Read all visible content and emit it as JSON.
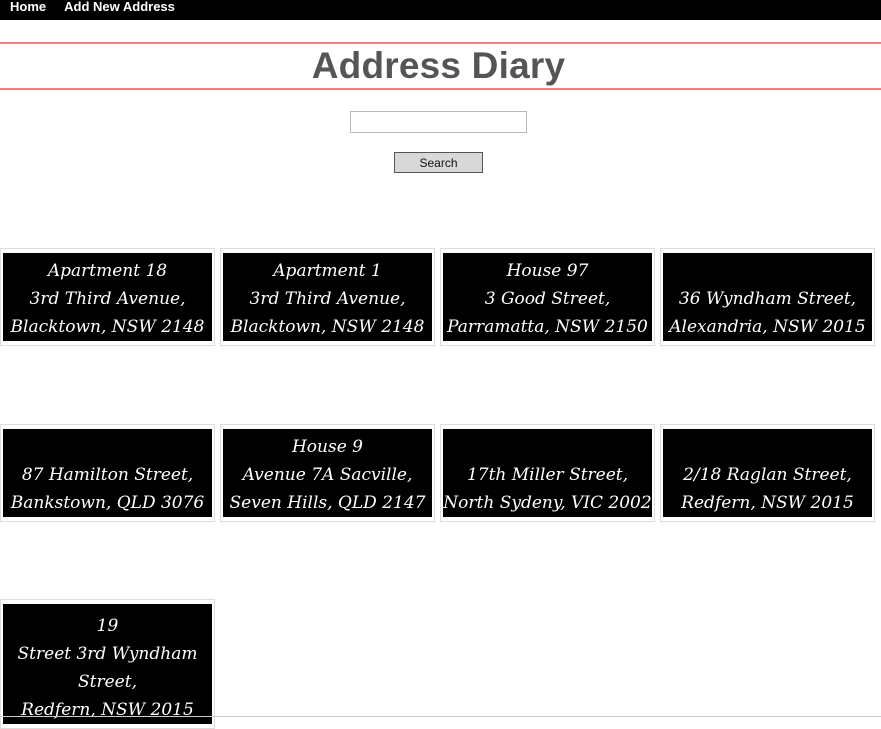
{
  "nav": {
    "home_label": "Home",
    "add_label": "Add New Address"
  },
  "header": {
    "title": "Address Diary"
  },
  "search": {
    "value": "",
    "placeholder": "",
    "button_label": "Search"
  },
  "addresses": [
    {
      "lines": [
        "Apartment 18",
        "3rd Third Avenue,",
        "Blacktown, NSW 2148"
      ]
    },
    {
      "lines": [
        "Apartment 1",
        "3rd Third Avenue,",
        "Blacktown, NSW 2148"
      ]
    },
    {
      "lines": [
        "House 97",
        "3 Good Street,",
        "Parramatta, NSW 2150"
      ]
    },
    {
      "lines": [
        "36 Wyndham Street,",
        "Alexandria, NSW 2015"
      ]
    },
    {
      "lines": [
        "87 Hamilton Street,",
        "Bankstown, QLD 3076"
      ]
    },
    {
      "lines": [
        "House 9",
        "Avenue 7A Sacville,",
        "Seven Hills, QLD 2147"
      ]
    },
    {
      "lines": [
        "17th Miller Street,",
        "North Sydeny, VIC 2002"
      ]
    },
    {
      "lines": [
        "2/18 Raglan Street,",
        "Redfern, NSW 2015"
      ]
    },
    {
      "lines": [
        "19",
        "Street 3rd Wyndham",
        "Street,",
        "Redfern, NSW 2015"
      ]
    }
  ]
}
